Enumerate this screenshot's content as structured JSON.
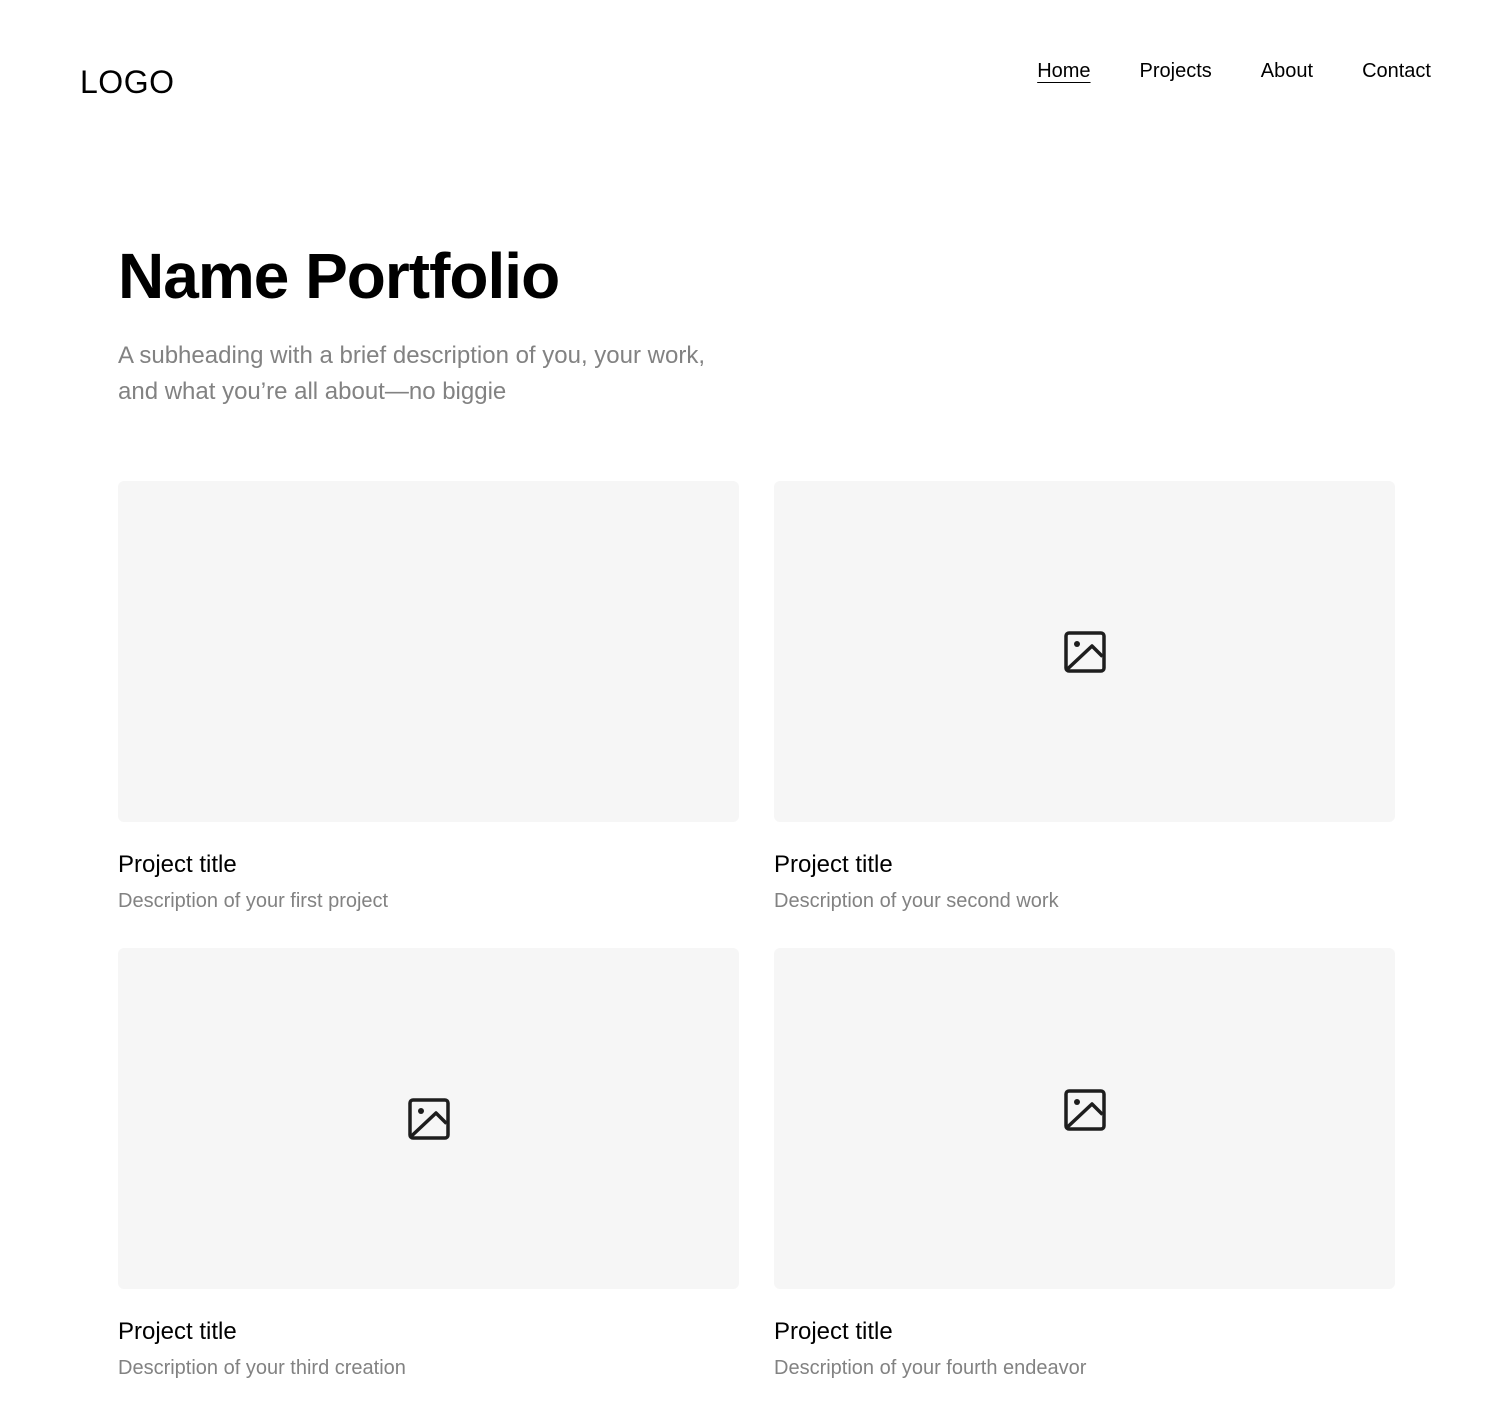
{
  "header": {
    "logo": "LOGO",
    "nav": [
      {
        "label": "Home",
        "active": true
      },
      {
        "label": "Projects",
        "active": false
      },
      {
        "label": "About",
        "active": false
      },
      {
        "label": "Contact",
        "active": false
      }
    ]
  },
  "hero": {
    "title": "Name Portfolio",
    "subtitle": "A subheading with a brief description of you, your work, and what you’re all about—no biggie"
  },
  "projects": [
    {
      "title": "Project title",
      "description": "Description of your first project",
      "image_icon": "none"
    },
    {
      "title": "Project title",
      "description": "Description of your second work",
      "image_icon": "image-icon"
    },
    {
      "title": "Project title",
      "description": "Description of your third creation",
      "image_icon": "image-icon"
    },
    {
      "title": "Project title",
      "description": "Description of your fourth endeavor",
      "image_icon": "image-icon"
    }
  ],
  "colors": {
    "text": "#000000",
    "muted": "#828282",
    "placeholder_bg": "#f6f6f6",
    "icon": "#1e1e1e",
    "background": "#ffffff"
  }
}
